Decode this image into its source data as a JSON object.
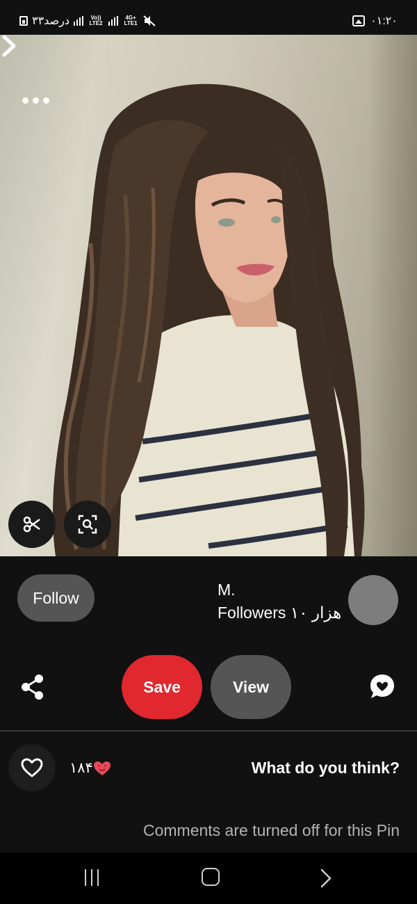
{
  "status_bar": {
    "battery_text": "۳۳درصد",
    "time": "۰۱:۲۰",
    "network_labels": [
      "Vo)) LTE2",
      "4G+ LTE1"
    ],
    "icons": [
      "battery-saver-icon",
      "signal-icon",
      "mute-icon",
      "gallery-icon"
    ]
  },
  "pin": {
    "image_description_icon": "photo",
    "more_icon": "more-dots-icon",
    "next_icon": "chevron-right-icon",
    "tools": [
      "scissors-icon",
      "visual-search-icon"
    ]
  },
  "creator": {
    "name": "M.",
    "followers": "Followers ۱۰ هزار",
    "follow_label": "Follow"
  },
  "actions": {
    "save_label": "Save",
    "view_label": "View",
    "share_icon": "share-icon",
    "comment_icon": "comment-icon"
  },
  "reactions": {
    "count": "۱۸۴",
    "like_icon": "heart-outline-icon",
    "reaction_icon": "heart-eyes-icon",
    "prompt": "What do you think?",
    "comments_off": "Comments are turned off for this Pin"
  },
  "navbar": {
    "icons": [
      "recent-apps-icon",
      "home-icon",
      "back-icon"
    ]
  },
  "colors": {
    "background": "#111111",
    "save_red": "#e0282e",
    "pill_gray": "#555555",
    "muted_text": "#b3b3b3"
  }
}
